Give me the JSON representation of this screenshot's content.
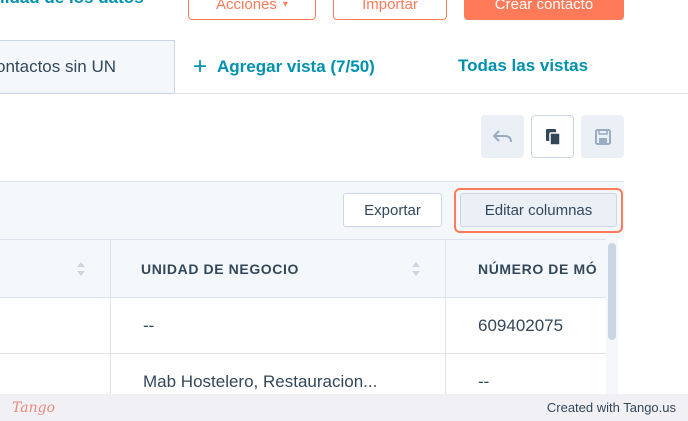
{
  "header": {
    "partial_link": "lidad de los datos",
    "actions_label": "Acciones",
    "import_label": "Importar",
    "create_label": "Crear contacto"
  },
  "tabs": {
    "active_label": "ontactos sin UN",
    "add_view_label": "Agregar vista (7/50)",
    "all_views_label": "Todas las vistas"
  },
  "toolbar": {
    "export_label": "Exportar",
    "edit_columns_label": "Editar columnas",
    "icons": [
      "undo-icon",
      "copy-icon",
      "save-icon"
    ]
  },
  "table": {
    "columns": [
      "",
      "UNIDAD DE NEGOCIO",
      "NÚMERO DE MÓ"
    ],
    "rows": [
      [
        "",
        "--",
        "609402075"
      ],
      [
        "",
        "Mab Hostelero, Restauracion...",
        "--"
      ]
    ]
  },
  "footer": {
    "logo": "Tango",
    "credit": "Created with Tango.us"
  },
  "colors": {
    "accent": "#ff7a59",
    "link": "#0091ae",
    "text": "#33475b"
  }
}
